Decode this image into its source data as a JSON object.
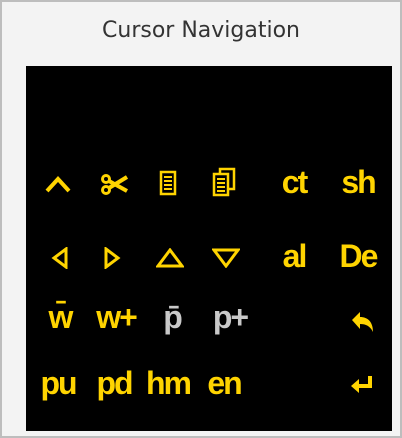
{
  "window": {
    "title": "Cursor Navigation"
  },
  "colors": {
    "accent": "#ffd400",
    "disabled": "#c9c9c9",
    "pad_bg": "#000000"
  },
  "keys": [
    {
      "name": "up-icon",
      "icon": "caret-up"
    },
    {
      "name": "cut-icon",
      "icon": "scissors"
    },
    {
      "name": "copy-icon",
      "icon": "document"
    },
    {
      "name": "paste-icon",
      "icon": "documents"
    },
    {
      "name": "ct",
      "label": "ct"
    },
    {
      "name": "sh",
      "label": "sh"
    },
    {
      "name": "left-icon",
      "icon": "triangle-left"
    },
    {
      "name": "right-icon",
      "icon": "triangle-right"
    },
    {
      "name": "triangle-up-icon",
      "icon": "triangle-up"
    },
    {
      "name": "triangle-down-icon",
      "icon": "triangle-down"
    },
    {
      "name": "al",
      "label": "al"
    },
    {
      "name": "de",
      "label": "De"
    },
    {
      "name": "prev-word",
      "label": "w̄"
    },
    {
      "name": "next-word",
      "label": "w+"
    },
    {
      "name": "prev-page",
      "label": "p̄"
    },
    {
      "name": "next-page",
      "label": "p+"
    },
    {
      "name": "undo-icon",
      "icon": "undo-arrow"
    },
    {
      "name": "pu",
      "label": "pu"
    },
    {
      "name": "pd",
      "label": "pd"
    },
    {
      "name": "hm",
      "label": "hm"
    },
    {
      "name": "en",
      "label": "en"
    },
    {
      "name": "enter-icon",
      "icon": "return-arrow"
    }
  ]
}
